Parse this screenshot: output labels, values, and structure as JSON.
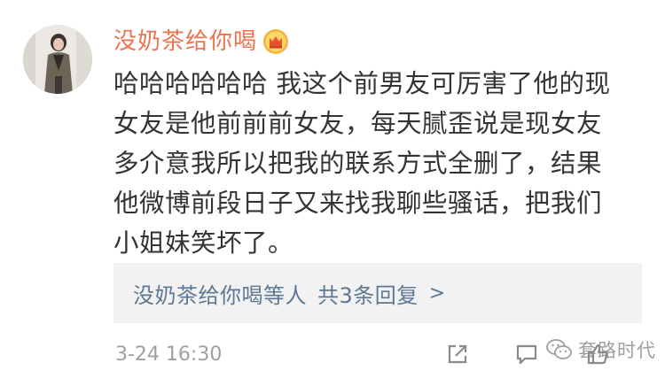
{
  "comment": {
    "username": "没奶茶给你喝",
    "badge": "crown-badge",
    "text": "哈哈哈哈哈哈 我这个前男友可厉害了他的现\n女友是他前前前女友，每天腻歪说是现女友\n多介意我所以把我的联系方式全删了，结果\n他微博前段日子又来找我聊些骚话，把我们\n小姐妹笑坏了。",
    "timestamp": "3-24 16:30"
  },
  "replies": {
    "who": "没奶茶给你喝等人",
    "count": "共3条回复",
    "chevron": ">"
  },
  "actions": {
    "share_icon": "share-icon",
    "comment_icon": "comment-icon",
    "like_icon": "like-icon"
  },
  "watermark": {
    "text": "套路时代"
  },
  "colors": {
    "username": "#eb7350",
    "reply_link": "#5d7895",
    "body_text": "#333333",
    "meta_text": "#a0a0a0",
    "reply_bg": "#f2f2f2"
  }
}
